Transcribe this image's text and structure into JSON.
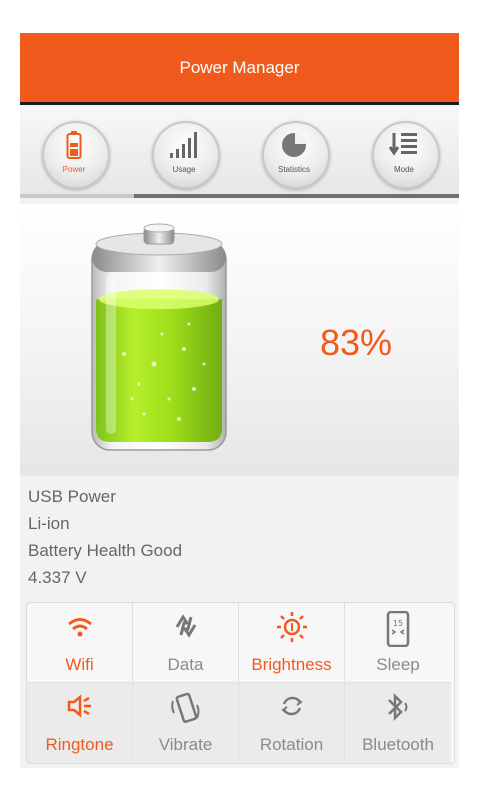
{
  "header": {
    "title": "Power Manager"
  },
  "tabs": [
    {
      "label": "Power",
      "icon": "battery-icon",
      "active": true
    },
    {
      "label": "Usage",
      "icon": "bar-chart-icon",
      "active": false
    },
    {
      "label": "Statistics",
      "icon": "pie-chart-icon",
      "active": false
    },
    {
      "label": "Mode",
      "icon": "list-icon",
      "active": false
    }
  ],
  "battery": {
    "level_percent": 83,
    "percent_text": "83%",
    "power_source": "USB Power",
    "type": "Li-ion",
    "health": "Battery Health Good",
    "voltage": "4.337 V"
  },
  "toggles": [
    {
      "label": "Wifi",
      "icon": "wifi-icon",
      "on": true
    },
    {
      "label": "Data",
      "icon": "data-sync-icon",
      "on": false
    },
    {
      "label": "Brightness",
      "icon": "brightness-icon",
      "on": true
    },
    {
      "label": "Sleep",
      "icon": "sleep-icon",
      "on": false
    },
    {
      "label": "Ringtone",
      "icon": "speaker-icon",
      "on": true
    },
    {
      "label": "Vibrate",
      "icon": "vibrate-icon",
      "on": false
    },
    {
      "label": "Rotation",
      "icon": "rotation-icon",
      "on": false
    },
    {
      "label": "Bluetooth",
      "icon": "bluetooth-icon",
      "on": false
    }
  ],
  "colors": {
    "accent": "#f15a1d",
    "battery_fill": "#9edd1a",
    "inactive": "#8a8a8a"
  }
}
